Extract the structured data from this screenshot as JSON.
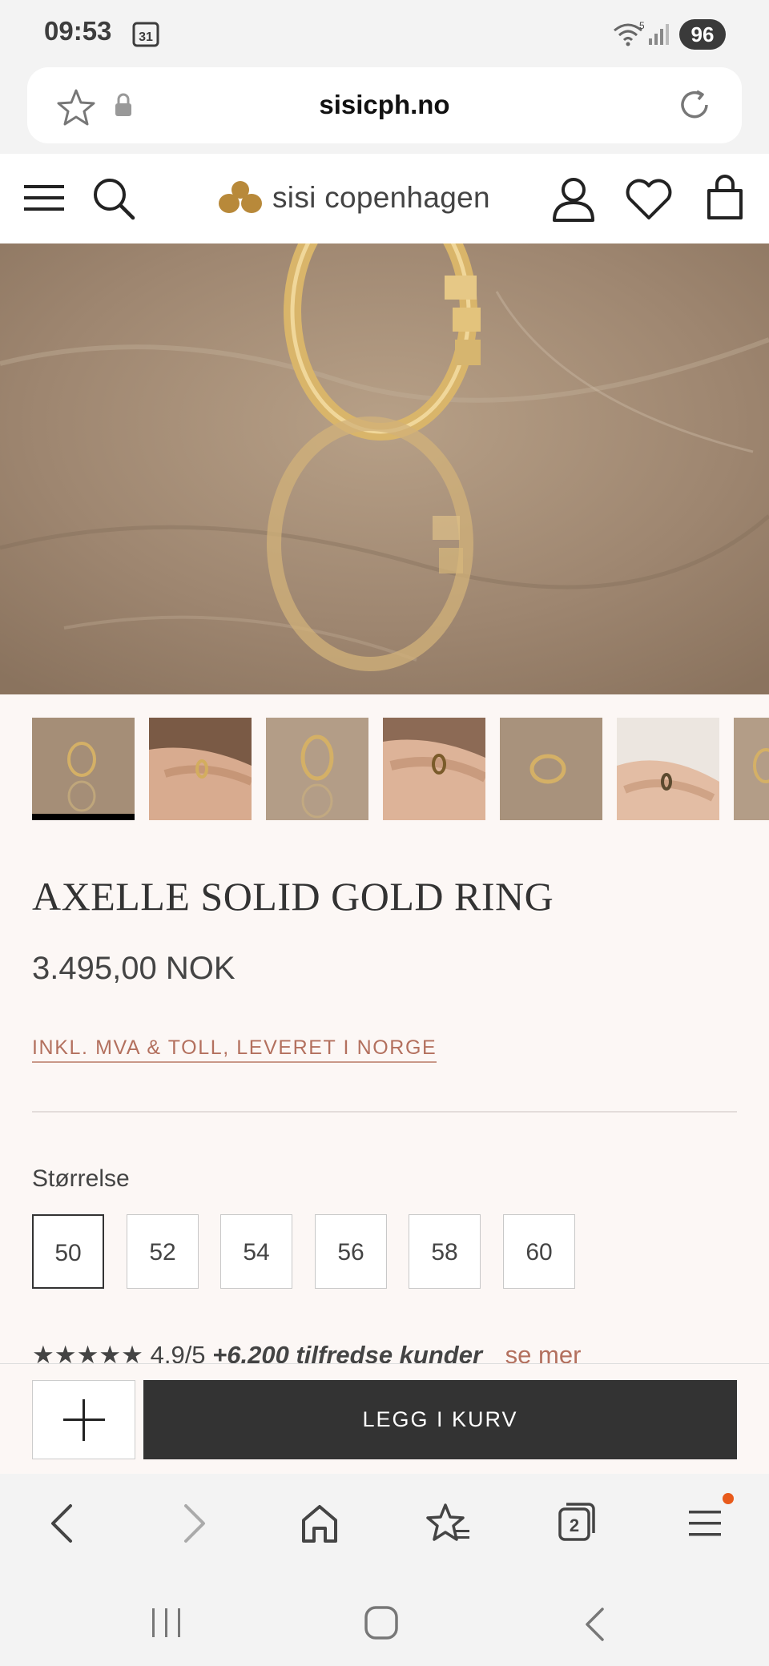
{
  "status_bar": {
    "time": "09:53",
    "calendar_day": "31",
    "wifi_label": "5",
    "battery": "96"
  },
  "browser": {
    "url": "sisicph.no",
    "tab_count": "2"
  },
  "site_header": {
    "logo_text": "sisi copenhagen"
  },
  "product": {
    "title": "AXELLE SOLID GOLD RING",
    "price": "3.495,00 NOK",
    "tax_note": "INKL. MVA & TOLL, LEVERET I NORGE",
    "size_label": "Størrelse",
    "sizes": [
      "50",
      "52",
      "54",
      "56",
      "58",
      "60"
    ],
    "selected_size": "50",
    "rating": {
      "stars": "★★★★★",
      "score": "4.9/5",
      "customers": "+6.200 tilfredse kunder",
      "see_more": "se mer"
    }
  },
  "cart": {
    "add_label": "LEGG I KURV"
  },
  "thumbnails": [
    {
      "name": "ring-on-stone",
      "active": true
    },
    {
      "name": "ring-on-hand-1",
      "active": false
    },
    {
      "name": "ring-on-stone-angle",
      "active": false
    },
    {
      "name": "ring-on-hand-2",
      "active": false
    },
    {
      "name": "ring-flat-on-stone",
      "active": false
    },
    {
      "name": "ring-on-hand-3",
      "active": false
    },
    {
      "name": "ring-partial",
      "active": false
    }
  ],
  "colors": {
    "accent_link": "#b3705e",
    "button_dark": "#333333",
    "page_bg": "#fcf7f5",
    "gold": "#c9a04c",
    "notification_dot": "#e85a1b"
  },
  "icons": [
    "calendar-icon",
    "wifi-icon",
    "signal-icon",
    "star-icon",
    "lock-icon",
    "reload-icon",
    "menu-icon",
    "search-icon",
    "logo-icon",
    "account-icon",
    "heart-icon",
    "bag-icon",
    "plus-icon",
    "back-icon",
    "forward-icon",
    "home-icon",
    "bookmarks-icon",
    "tabs-icon",
    "browser-menu-icon",
    "recents-icon",
    "home-button-icon",
    "system-back-icon"
  ]
}
